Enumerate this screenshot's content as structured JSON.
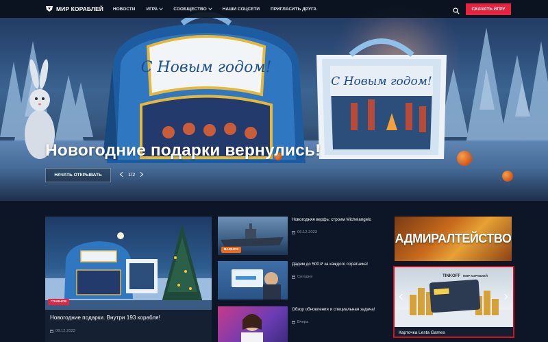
{
  "nav": {
    "logo_text": "МИР КОРАБЛЕЙ",
    "items": [
      {
        "label": "НОВОСТИ",
        "has_dropdown": false
      },
      {
        "label": "ИГРА",
        "has_dropdown": true
      },
      {
        "label": "СООБЩЕСТВО",
        "has_dropdown": true
      },
      {
        "label": "НАШИ СОЦСЕТИ",
        "has_dropdown": false
      },
      {
        "label": "ПРИГЛАСИТЬ ДРУГА",
        "has_dropdown": false
      }
    ],
    "download_label": "СКАЧАТЬ ИГРУ"
  },
  "hero": {
    "big_box_text": "С Новым годом!",
    "small_box_text": "С Новым годом!",
    "title": "Новогодние подарки вернулись!",
    "button_label": "НАЧАТЬ ОТКРЫВАТЬ",
    "pager": "1/2"
  },
  "main_news": {
    "badge": "ГЛАВНОЕ",
    "title": "Новогодние подарки. Внутри 193 корабля!",
    "date": "08.12.2023"
  },
  "news": [
    {
      "title": "Новогодняя верфь: строим Michelangelo",
      "date": "06.12.2023",
      "badge": "ВАЖНОЕ"
    },
    {
      "title": "Дадим до 500 ₽ за каждого соратника!",
      "date": "Сегодня",
      "badge": ""
    },
    {
      "title": "Обзор обновления и специальная задача!",
      "date": "Вчера",
      "badge": ""
    }
  ],
  "sidebar": {
    "admiralty_text": "АДМИРАЛТЕЙСТВО",
    "card_title": "Карточка Lesta Games",
    "card_brand": "TINKOFF",
    "card_brand2": "МИР КОРАБЛЕЙ"
  },
  "colors": {
    "accent_red": "#e8233f",
    "badge_orange": "#f06a1c",
    "highlight_border": "#d0131f"
  }
}
